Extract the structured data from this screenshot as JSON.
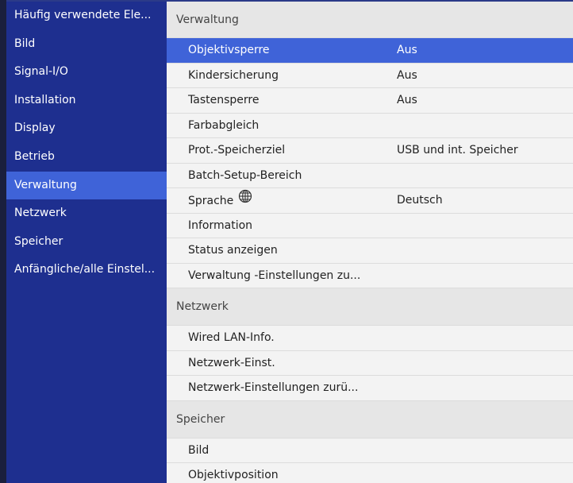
{
  "sidebar": {
    "items": [
      {
        "label": "Häufig verwendete Ele..."
      },
      {
        "label": "Bild"
      },
      {
        "label": "Signal-I/O"
      },
      {
        "label": "Installation"
      },
      {
        "label": "Display"
      },
      {
        "label": "Betrieb"
      },
      {
        "label": "Verwaltung"
      },
      {
        "label": "Netzwerk"
      },
      {
        "label": "Speicher"
      },
      {
        "label": "Anfängliche/alle Einstel..."
      }
    ],
    "active_index": 6
  },
  "sections": [
    {
      "header": "Verwaltung",
      "items": [
        {
          "label": "Objektivsperre",
          "value": "Aus",
          "selected": true
        },
        {
          "label": "Kindersicherung",
          "value": "Aus"
        },
        {
          "label": "Tastensperre",
          "value": "Aus"
        },
        {
          "label": "Farbabgleich",
          "value": ""
        },
        {
          "label": "Prot.-Speicherziel",
          "value": "USB und int. Speicher"
        },
        {
          "label": "Batch-Setup-Bereich",
          "value": ""
        },
        {
          "label": "Sprache",
          "value": "Deutsch",
          "icon": "globe-icon"
        },
        {
          "label": "Information",
          "value": ""
        },
        {
          "label": "Status anzeigen",
          "value": ""
        },
        {
          "label": "Verwaltung -Einstellungen zu...",
          "value": ""
        }
      ]
    },
    {
      "header": "Netzwerk",
      "items": [
        {
          "label": "Wired LAN-Info.",
          "value": ""
        },
        {
          "label": "Netzwerk-Einst.",
          "value": ""
        },
        {
          "label": "Netzwerk-Einstellungen zurü...",
          "value": ""
        }
      ]
    },
    {
      "header": "Speicher",
      "items": [
        {
          "label": "Bild",
          "value": ""
        },
        {
          "label": "Objektivposition",
          "value": ""
        }
      ]
    }
  ],
  "colors": {
    "sidebar_bg": "#1e2f8f",
    "highlight": "#3f63d8",
    "panel_bg": "#f3f3f3",
    "header_bg": "#e6e6e6"
  }
}
